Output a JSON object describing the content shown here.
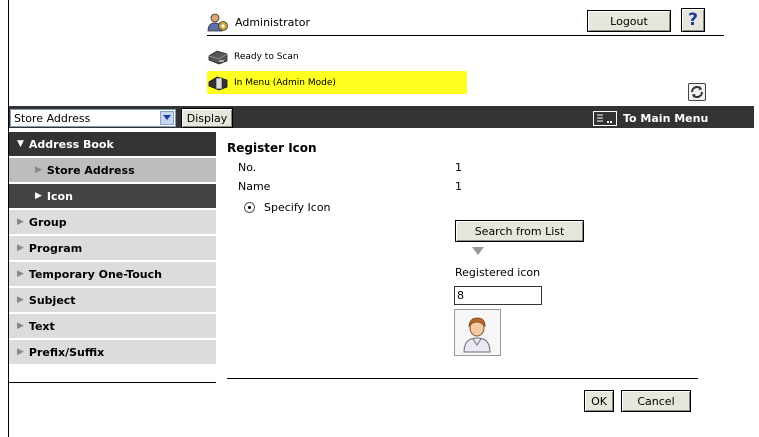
{
  "header": {
    "user_label": "Administrator",
    "logout_label": "Logout",
    "help_label": "?"
  },
  "status": {
    "line1": "Ready to Scan",
    "line2": "In Menu (Admin Mode)",
    "highlight_color": "#ffff22"
  },
  "toolbar": {
    "select_value": "Store Address",
    "display_label": "Display",
    "main_menu_label": "To Main Menu"
  },
  "sidebar": {
    "items": [
      {
        "label": "Address Book",
        "type": "header"
      },
      {
        "label": "Store Address",
        "type": "sub"
      },
      {
        "label": "Icon",
        "type": "sub-active"
      },
      {
        "label": "Group",
        "type": "item"
      },
      {
        "label": "Program",
        "type": "item"
      },
      {
        "label": "Temporary One-Touch",
        "type": "item"
      },
      {
        "label": "Subject",
        "type": "item"
      },
      {
        "label": "Text",
        "type": "item"
      },
      {
        "label": "Prefix/Suffix",
        "type": "item"
      }
    ]
  },
  "main": {
    "title": "Register Icon",
    "no_label": "No.",
    "no_value": "1",
    "name_label": "Name",
    "name_value": "1",
    "specify_label": "Specify Icon",
    "search_label": "Search from List",
    "registered_label": "Registered icon",
    "registered_value": "8",
    "ok_label": "OK",
    "cancel_label": "Cancel"
  },
  "colors": {
    "dark_bar": "#333333",
    "sidebar_item": "#dcdcdc",
    "sidebar_sub": "#bdbdbd"
  }
}
